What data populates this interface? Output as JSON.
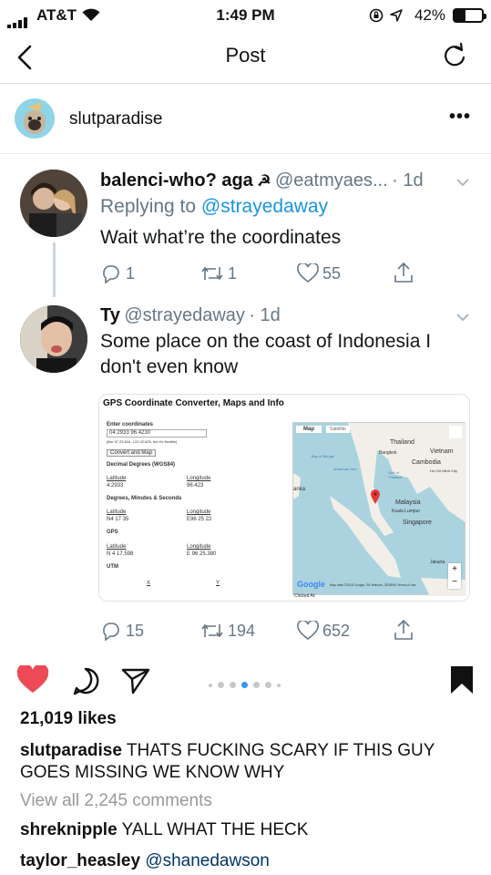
{
  "status_bar": {
    "carrier": "AT&T",
    "time": "1:49 PM",
    "battery_pct": "42%"
  },
  "nav": {
    "title": "Post"
  },
  "post": {
    "username": "slutparadise",
    "tweet1": {
      "name": "balenci-who? aga",
      "name_icon": "☭",
      "handle": "@eatmyaes...",
      "time": "· 1d",
      "replying_prefix": "Replying to",
      "replying_handle": "@strayedaway",
      "text": "Wait what’re the coordinates",
      "replies": "1",
      "retweets": "1",
      "likes": "55"
    },
    "tweet2": {
      "name": "Ty",
      "handle": "@strayedaway",
      "time": "· 1d",
      "text": "Some place on the coast of Indonesia I don't even know",
      "replies": "15",
      "retweets": "194",
      "likes": "652",
      "card": {
        "title": "GPS Coordinate Converter, Maps and Info",
        "enter": "Enter coordinates",
        "coords": "04.2933 96.4230",
        "hint": "(like 37 23.516 -122 02.625, but it's flexible)",
        "convert": "Convert and Map",
        "dd": "Decimal Degrees (WGS84)",
        "lat_label": "Latitude",
        "lon_label": "Longitude",
        "lat_dd": "4.2933",
        "lon_dd": "96.423",
        "dms": "Degrees, Minutes & Seconds",
        "lat_dms": "N4 17 35",
        "lon_dms": "E96 25 22",
        "gps": "GPS",
        "lat_gps": "N 4 17.598",
        "lon_gps": "E 96 25.380",
        "utm": "UTM",
        "x": "X",
        "y": "Y",
        "map_tab": "Map",
        "sat_tab": "Satellite",
        "thailand": "Thailand",
        "bangkok": "Bangkok",
        "bay": "Bay of Bengal",
        "andaman": "Andaman Sea",
        "gulf": "Gulf of Thailand",
        "vietnam": "Vietnam",
        "cambodia": "Cambodia",
        "hcm": "Ho Chi Minh City",
        "lanka": "anka",
        "malaysia": "Malaysia",
        "kl": "Kuala Lumpur",
        "singapore": "Singapore",
        "jakarta": "Jakarta",
        "google": "Google",
        "mapdata": "Map data ©2018 Google, SK telecom, ZENRIN   Terms of Use",
        "clicked": "Clicked At:"
      }
    },
    "carousel_total": 7,
    "carousel_active": 4,
    "likes": "21,019 likes",
    "caption_user": "slutparadise",
    "caption_text": "THATS FUCKING SCARY IF THIS GUY GOES MISSING WE KNOW WHY",
    "view_all": "View all 2,245 comments",
    "comments": [
      {
        "user": "shreknipple",
        "text": "YALL WHAT THE HECK"
      },
      {
        "user": "taylor_heasley",
        "text": "@shanedawson"
      }
    ]
  }
}
